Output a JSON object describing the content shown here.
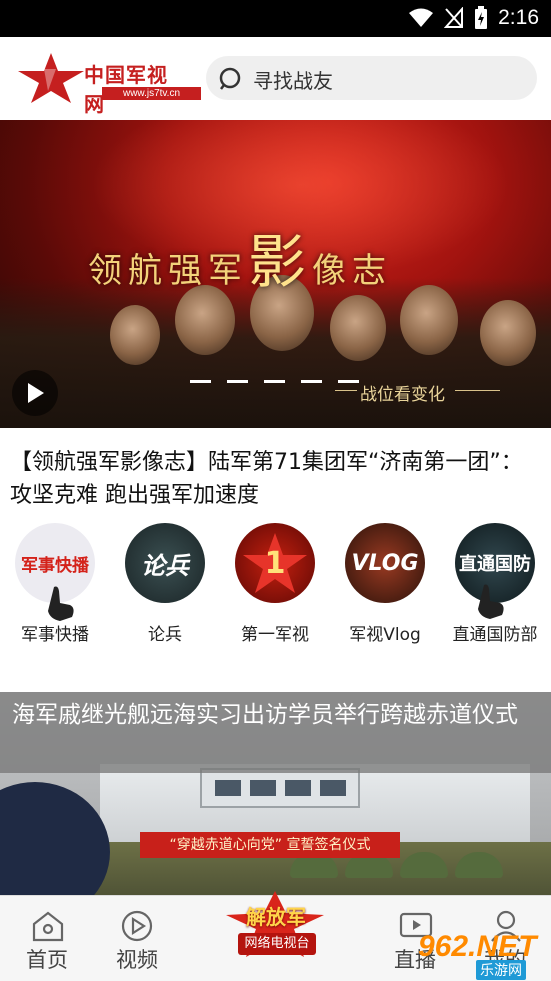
{
  "status_bar": {
    "time": "2:16"
  },
  "header": {
    "logo_text": "中国军视网",
    "logo_url": "www.js7tv.cn",
    "search_placeholder": "寻找战友"
  },
  "banner": {
    "title_part1": "领航强军",
    "title_big": "影",
    "title_part2": "像志",
    "subtitle": "战位看变化",
    "slide_count": 5
  },
  "headline": "【领航强军影像志】陆军第71集团军“济南第一团”：攻坚克难 跑出强军加速度",
  "categories": [
    {
      "label": "军事快播",
      "badge": "军事快播",
      "color": "#e8e8ee"
    },
    {
      "label": "论兵",
      "badge": "论兵",
      "color": "#2d3b3f"
    },
    {
      "label": "第一军视",
      "badge": "1",
      "color": "#8a0d0a"
    },
    {
      "label": "军视Vlog",
      "badge": "VLOG",
      "color": "#5a2a18"
    },
    {
      "label": "直通国防部",
      "badge": "直通国防",
      "color": "#22343a"
    }
  ],
  "news_card": {
    "caption": "海军戚继光舰远海实习出访学员举行跨越赤道仪式",
    "banner_text": "“穿越赤道心向党” 宣誓签名仪式"
  },
  "bottom_nav": {
    "home": "首页",
    "video": "视频",
    "center_title": "解放军",
    "center_sub": "网络电视台",
    "live": "直播",
    "me": "我的"
  },
  "watermark": {
    "text": "962.NET",
    "sub": "乐游网"
  }
}
